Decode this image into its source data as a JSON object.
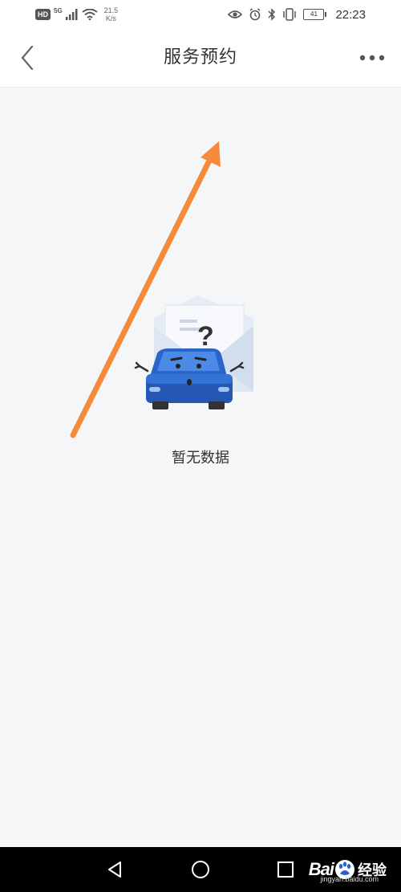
{
  "status_bar": {
    "network_badge": "HD",
    "network_type": "5G",
    "speed_value": "21.5",
    "speed_unit": "K/s",
    "battery_level": "41",
    "time": "22:23"
  },
  "navbar": {
    "title": "服务预约",
    "back_icon": "chevron-left-icon",
    "more_icon": "more-horizontal-icon"
  },
  "empty_state": {
    "illustration": "car-envelope-question-icon",
    "message": "暂无数据"
  },
  "annotation": {
    "arrow_color": "#f58a3c"
  },
  "system_nav": {
    "back_icon": "triangle-back-icon",
    "home_icon": "circle-home-icon",
    "recents_icon": "square-recents-icon"
  },
  "watermark": {
    "brand_left": "Bai",
    "brand_right": "经验",
    "url": "jingyan.baidu.com"
  }
}
